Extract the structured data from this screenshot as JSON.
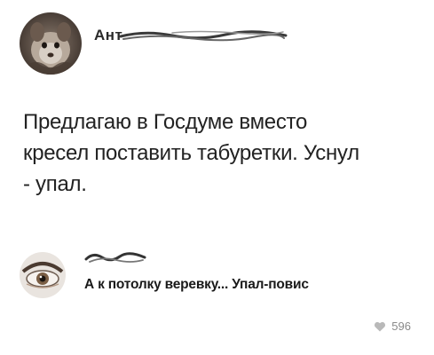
{
  "post": {
    "author_name": "Ант",
    "text_lines": [
      "Предлагаю в Госдуме вместо",
      "кресел поставить табуретки. Уснул",
      "- упал."
    ]
  },
  "comment": {
    "text": "А к потолку веревку... Упал-повис",
    "likes": "596"
  },
  "icons": {
    "like": "heart-icon"
  },
  "colors": {
    "text": "#1f1f1f",
    "muted": "#8a8a8a"
  }
}
